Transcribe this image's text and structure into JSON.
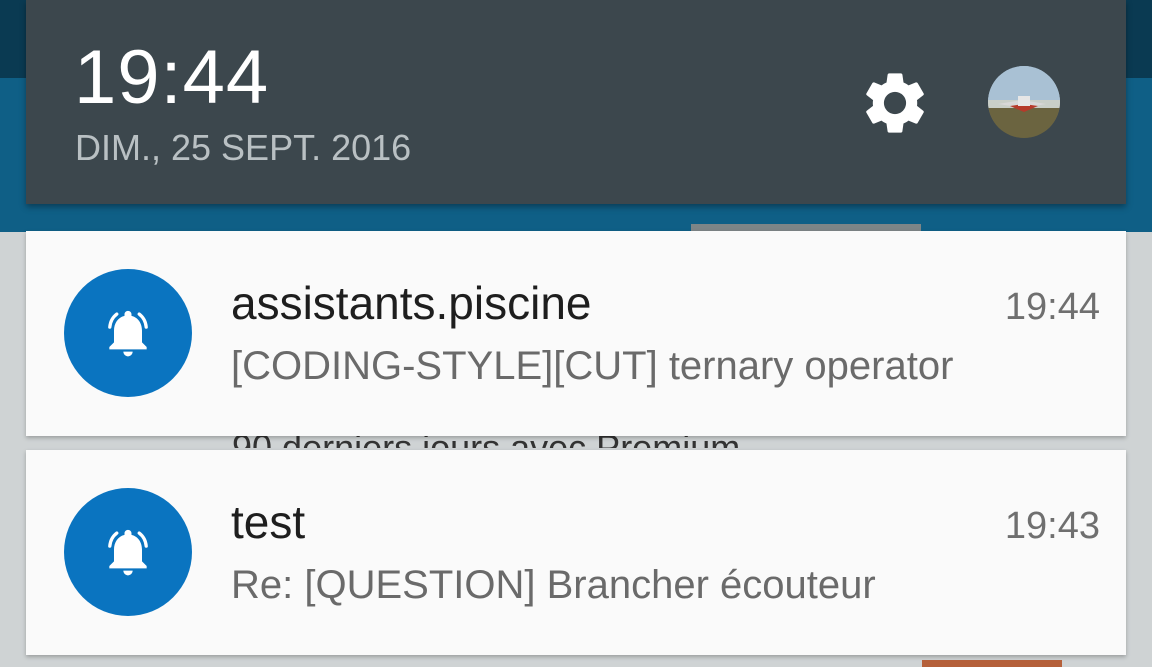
{
  "status": {
    "time": "19:44",
    "date": "DIM., 25 SEPT. 2016"
  },
  "header_icons": {
    "settings_icon": "gear-icon",
    "user_icon": "avatar-photo"
  },
  "background": {
    "peek_text": "90 derniers jours avec Premium"
  },
  "notifications": [
    {
      "icon": "bell-ringing-icon",
      "title": "assistants.piscine",
      "text": "[CODING-STYLE][CUT] ternary operator",
      "time": "19:44"
    },
    {
      "icon": "bell-ringing-icon",
      "title": "test",
      "text": "Re: [QUESTION] Brancher écouteur",
      "time": "19:43"
    }
  ],
  "colors": {
    "header_bg": "#3c474d",
    "icon_circle": "#0a74c0",
    "card_bg": "#fafafa"
  }
}
